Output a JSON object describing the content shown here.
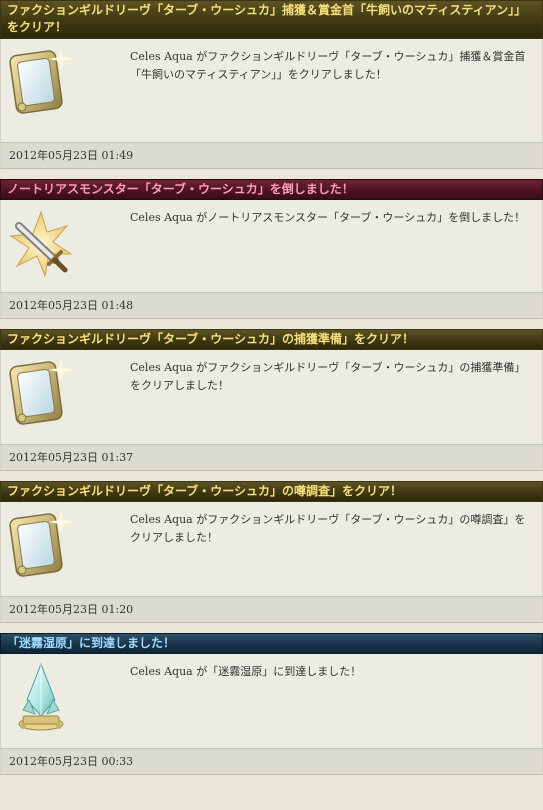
{
  "entries": [
    {
      "title": "ファクションギルドリーヴ「ターブ・ウーシュカ」捕獲＆賞金首「牛飼いのマティスティアン」」をクリア！",
      "text": "Celes Aqua がファクションギルドリーヴ「ターブ・ウーシュカ」捕獲＆賞金首「牛飼いのマティスティアン」」をクリアしました！",
      "timestamp": "2012年05月23日  01:49",
      "icon": "leve-card-icon",
      "header_style": "gold"
    },
    {
      "title": "ノートリアスモンスター「ターブ・ウーシュカ」を倒しました！",
      "text": "Celes Aqua がノートリアスモンスター「ターブ・ウーシュカ」を倒しました！",
      "timestamp": "2012年05月23日  01:48",
      "icon": "sword-burst-icon",
      "header_style": "red"
    },
    {
      "title": "ファクションギルドリーヴ「ターブ・ウーシュカ」の捕獲準備」をクリア！",
      "text": "Celes Aqua がファクションギルドリーヴ「ターブ・ウーシュカ」の捕獲準備」をクリアしました！",
      "timestamp": "2012年05月23日  01:37",
      "icon": "leve-card-icon",
      "header_style": "gold"
    },
    {
      "title": "ファクションギルドリーヴ「ターブ・ウーシュカ」の噂調査」をクリア！",
      "text": "Celes Aqua がファクションギルドリーヴ「ターブ・ウーシュカ」の噂調査」をクリアしました！",
      "timestamp": "2012年05月23日  01:20",
      "icon": "leve-card-icon",
      "header_style": "gold"
    },
    {
      "title": "「迷霧湿原」に到達しました！",
      "text": "Celes Aqua が「迷霧湿原」に到達しました！",
      "timestamp": "2012年05月23日  00:33",
      "icon": "aetheryte-crystal-icon",
      "header_style": "blue"
    }
  ],
  "colors": {
    "header_gold_text": "#f6e07a",
    "header_red_text": "#ff9cb5",
    "header_blue_text": "#9fdcff"
  }
}
